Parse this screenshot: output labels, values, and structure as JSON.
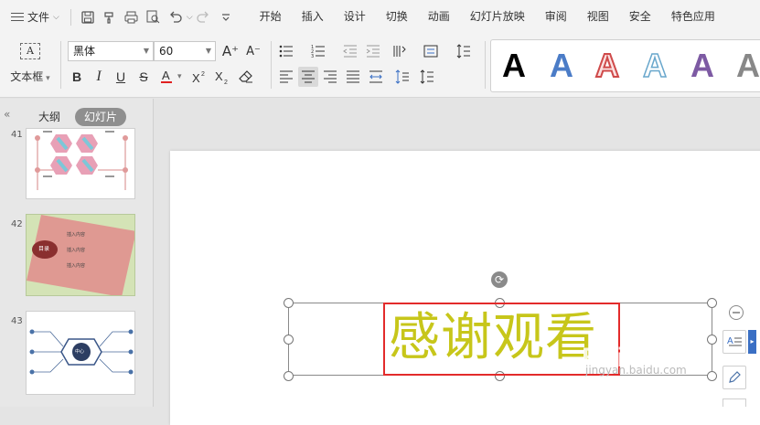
{
  "menubar": {
    "file_label": "文件",
    "tabs": [
      "开始",
      "插入",
      "设计",
      "切换",
      "动画",
      "幻灯片放映",
      "审阅",
      "视图",
      "安全",
      "特色应用"
    ]
  },
  "ribbon": {
    "textbox_label": "文本框",
    "font_name": "黑体",
    "font_size": "60",
    "textbox_icon_text": "A",
    "art_letters": [
      "A",
      "A",
      "A",
      "A",
      "A",
      "A"
    ],
    "grow_glyph": "A⁺",
    "shrink_glyph": "A⁻"
  },
  "leftpane": {
    "outline_tab": "大纲",
    "slides_tab": "幻灯片",
    "thumbs": [
      {
        "number": "41"
      },
      {
        "number": "42",
        "circle_text": "目录",
        "lines": [
          "插入内容",
          "插入内容",
          "插入内容"
        ]
      },
      {
        "number": "43",
        "center_text": "中心"
      }
    ]
  },
  "slide": {
    "title_text": "感谢观看"
  },
  "colors": {
    "title": "#c7c61a",
    "highlight_box": "#e32b2b",
    "slides_tab_bg": "#8f8f8f"
  },
  "watermark": {
    "main": "Bai 经验",
    "sub": "jingyan.baidu.com"
  }
}
